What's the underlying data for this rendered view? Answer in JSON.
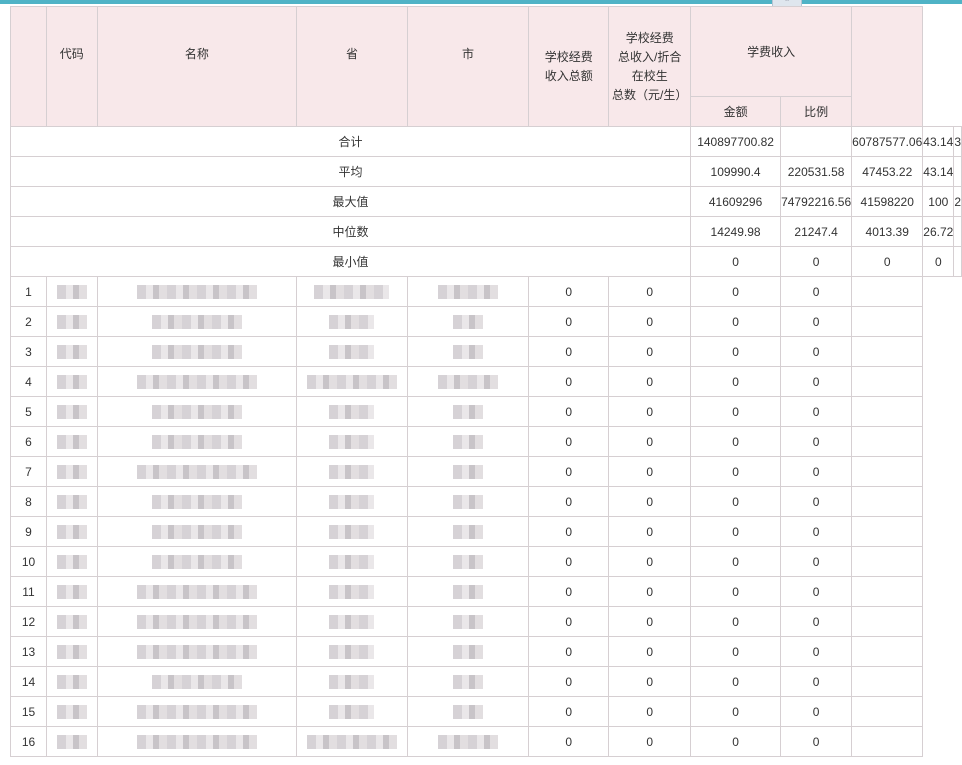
{
  "headers": {
    "code": "代码",
    "name": "名称",
    "province": "省",
    "city": "市",
    "total_income": [
      "学校经费",
      "收入总额"
    ],
    "per_student": [
      "学校经费",
      "总收入/折合",
      "在校生",
      "总数（元/生）"
    ],
    "tuition": "学费收入",
    "tuition_amount": "金额",
    "tuition_ratio": "比例"
  },
  "summary_rows": [
    {
      "label": "合计",
      "total": "140897700.82",
      "per_student": "",
      "amount": "60787577.06",
      "ratio": "43.14",
      "extra": "3"
    },
    {
      "label": "平均",
      "total": "109990.4",
      "per_student": "220531.58",
      "amount": "47453.22",
      "ratio": "43.14",
      "extra": ""
    },
    {
      "label": "最大值",
      "total": "41609296",
      "per_student": "74792216.56",
      "amount": "41598220",
      "ratio": "100",
      "extra": "2"
    },
    {
      "label": "中位数",
      "total": "14249.98",
      "per_student": "21247.4",
      "amount": "4013.39",
      "ratio": "26.72",
      "extra": ""
    },
    {
      "label": "最小值",
      "total": "0",
      "per_student": "0",
      "amount": "0",
      "ratio": "0",
      "extra": ""
    }
  ],
  "data_rows": [
    {
      "index": "1",
      "total": "0",
      "per_student": "0",
      "amount": "0",
      "ratio": "0"
    },
    {
      "index": "2",
      "total": "0",
      "per_student": "0",
      "amount": "0",
      "ratio": "0"
    },
    {
      "index": "3",
      "total": "0",
      "per_student": "0",
      "amount": "0",
      "ratio": "0"
    },
    {
      "index": "4",
      "total": "0",
      "per_student": "0",
      "amount": "0",
      "ratio": "0"
    },
    {
      "index": "5",
      "total": "0",
      "per_student": "0",
      "amount": "0",
      "ratio": "0"
    },
    {
      "index": "6",
      "total": "0",
      "per_student": "0",
      "amount": "0",
      "ratio": "0"
    },
    {
      "index": "7",
      "total": "0",
      "per_student": "0",
      "amount": "0",
      "ratio": "0"
    },
    {
      "index": "8",
      "total": "0",
      "per_student": "0",
      "amount": "0",
      "ratio": "0"
    },
    {
      "index": "9",
      "total": "0",
      "per_student": "0",
      "amount": "0",
      "ratio": "0"
    },
    {
      "index": "10",
      "total": "0",
      "per_student": "0",
      "amount": "0",
      "ratio": "0"
    },
    {
      "index": "11",
      "total": "0",
      "per_student": "0",
      "amount": "0",
      "ratio": "0"
    },
    {
      "index": "12",
      "total": "0",
      "per_student": "0",
      "amount": "0",
      "ratio": "0"
    },
    {
      "index": "13",
      "total": "0",
      "per_student": "0",
      "amount": "0",
      "ratio": "0"
    },
    {
      "index": "14",
      "total": "0",
      "per_student": "0",
      "amount": "0",
      "ratio": "0"
    },
    {
      "index": "15",
      "total": "0",
      "per_student": "0",
      "amount": "0",
      "ratio": "0"
    },
    {
      "index": "16",
      "total": "0",
      "per_student": "0",
      "amount": "0",
      "ratio": "0"
    }
  ]
}
